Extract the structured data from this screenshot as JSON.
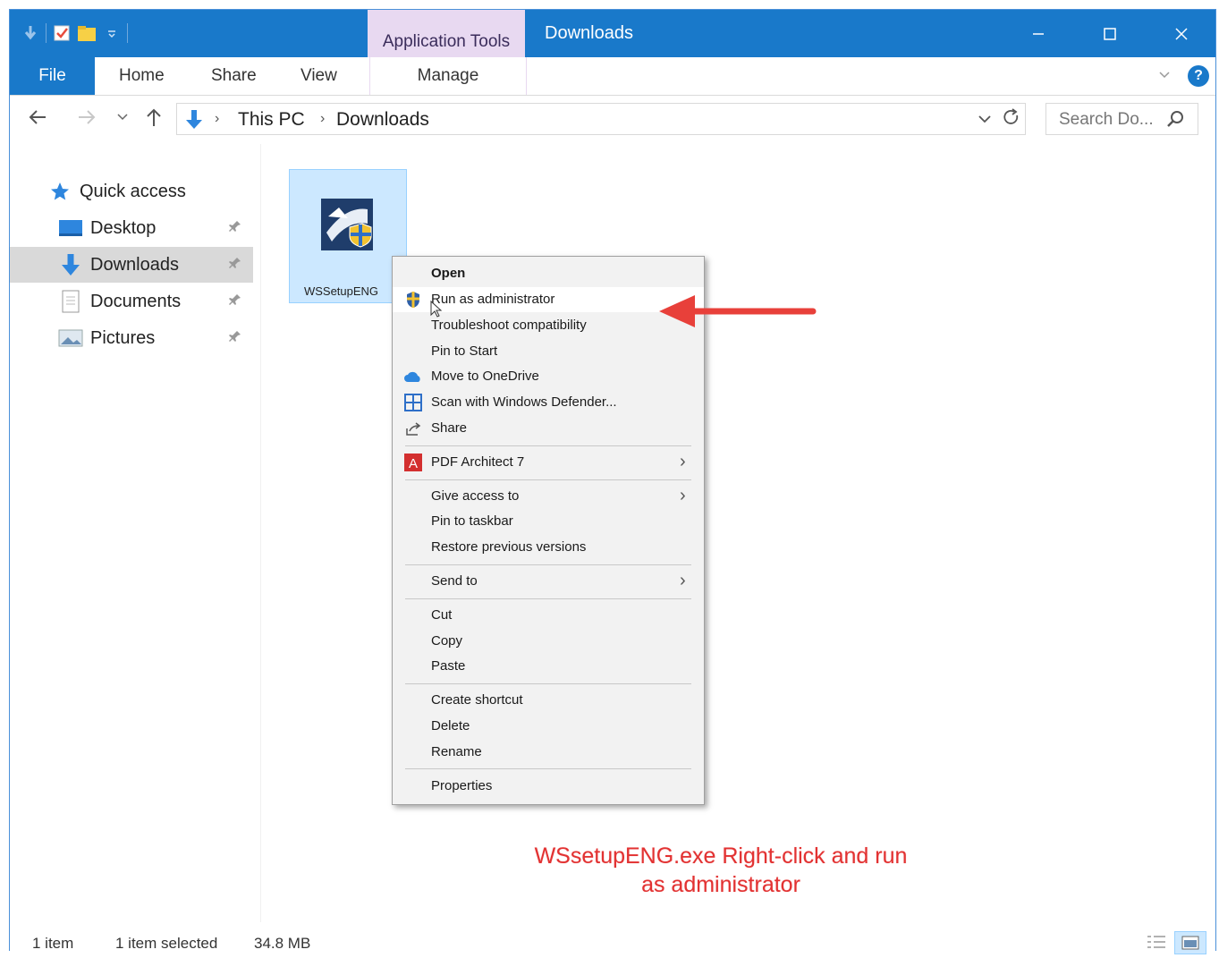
{
  "window": {
    "title": "Downloads",
    "contextual_tab": "Application Tools"
  },
  "ribbon": {
    "tabs": [
      "File",
      "Home",
      "Share",
      "View",
      "Manage"
    ],
    "help": "?"
  },
  "address": {
    "crumbs": [
      "This PC",
      "Downloads"
    ],
    "search_placeholder": "Search Do..."
  },
  "sidebar": {
    "quick_access": "Quick access",
    "items": [
      {
        "label": "Desktop",
        "icon": "desktop-icon"
      },
      {
        "label": "Downloads",
        "icon": "download-icon",
        "selected": true
      },
      {
        "label": "Documents",
        "icon": "documents-icon"
      },
      {
        "label": "Pictures",
        "icon": "pictures-icon"
      }
    ]
  },
  "file": {
    "name": "WSSetupENG"
  },
  "context_menu": {
    "items": [
      {
        "label": "Open"
      },
      {
        "label": "Run as administrator"
      },
      {
        "label": "Troubleshoot compatibility"
      },
      {
        "label": "Pin to Start"
      },
      {
        "label": "Move to OneDrive"
      },
      {
        "label": "Scan with Windows Defender..."
      },
      {
        "label": "Share"
      },
      {
        "label": "PDF Architect 7"
      },
      {
        "label": "Give access to"
      },
      {
        "label": "Pin to taskbar"
      },
      {
        "label": "Restore previous versions"
      },
      {
        "label": "Send to"
      },
      {
        "label": "Cut"
      },
      {
        "label": "Copy"
      },
      {
        "label": "Paste"
      },
      {
        "label": "Create shortcut"
      },
      {
        "label": "Delete"
      },
      {
        "label": "Rename"
      },
      {
        "label": "Properties"
      }
    ]
  },
  "annotation": {
    "line1": "WSsetupENG.exe Right-click and run",
    "line2": "as administrator"
  },
  "status": {
    "count": "1 item",
    "selected": "1 item selected",
    "size": "34.8 MB"
  },
  "colors": {
    "titlebar": "#1979ca",
    "contextual_tab": "#e8d9f1",
    "selection": "#cce8ff",
    "annotation": "#e23232"
  }
}
